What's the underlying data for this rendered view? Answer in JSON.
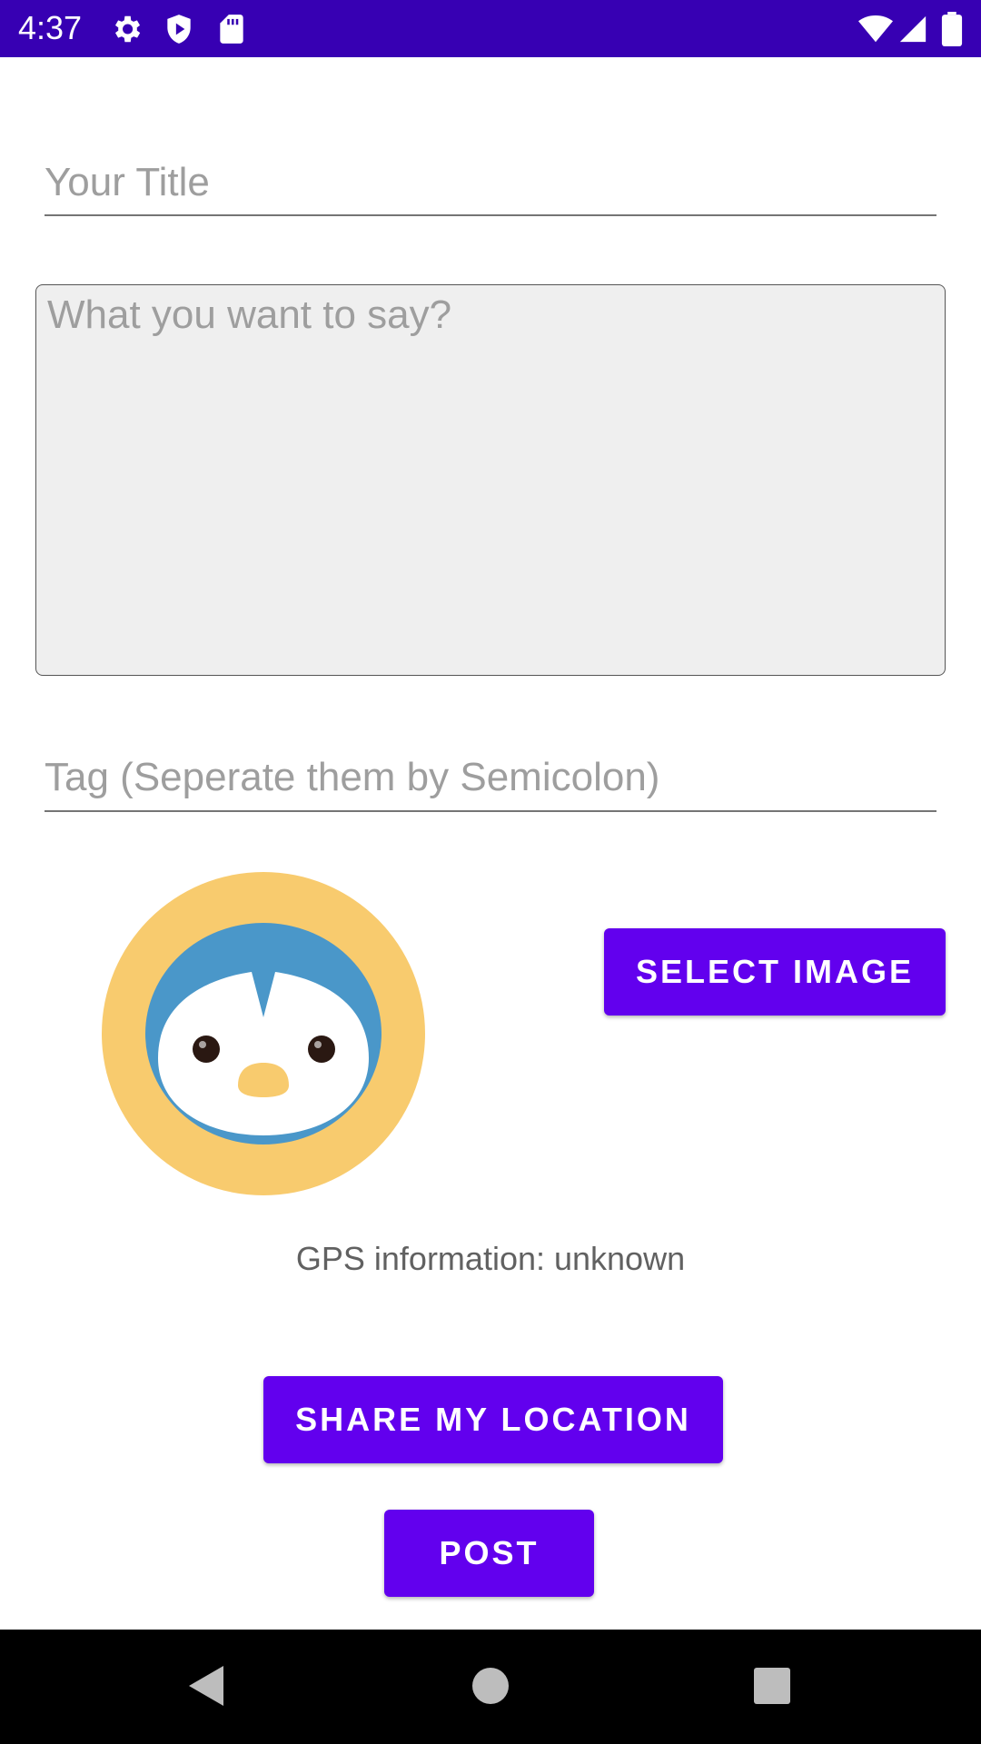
{
  "status_bar": {
    "time": "4:37",
    "icons": [
      "gear-icon",
      "shield-play-icon",
      "sd-card-icon",
      "wifi-icon",
      "signal-icon",
      "battery-icon"
    ],
    "background": "#3700b3"
  },
  "form": {
    "title_placeholder": "Your Title",
    "body_placeholder": "What you want to say?",
    "tag_placeholder": "Tag (Seperate them by Semicolon)"
  },
  "image_section": {
    "avatar_icon": "penguin-avatar-icon",
    "select_image_label": "SELECT IMAGE"
  },
  "gps": {
    "info_text": "GPS information: unknown"
  },
  "actions": {
    "share_location_label": "SHARE MY LOCATION",
    "post_label": "POST",
    "accent": "#6200ee"
  },
  "nav_bar": {
    "icons": [
      "back-icon",
      "home-icon",
      "recents-icon"
    ]
  }
}
